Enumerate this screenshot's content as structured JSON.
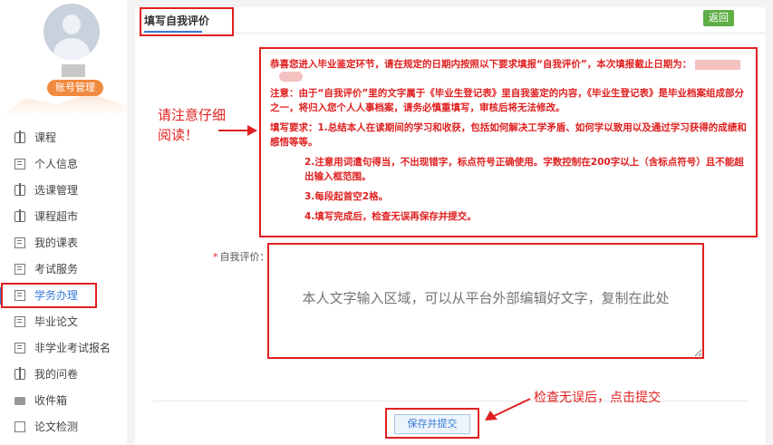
{
  "sidebar": {
    "account_button": "账号管理",
    "items": [
      {
        "label": "课程",
        "icon": "book-icon"
      },
      {
        "label": "个人信息",
        "icon": "list-icon"
      },
      {
        "label": "选课管理",
        "icon": "book-icon"
      },
      {
        "label": "课程超市",
        "icon": "book-icon"
      },
      {
        "label": "我的课表",
        "icon": "list-icon"
      },
      {
        "label": "考试服务",
        "icon": "list-icon"
      },
      {
        "label": "学务办理",
        "icon": "list-icon",
        "active": true
      },
      {
        "label": "毕业论文",
        "icon": "list-icon"
      },
      {
        "label": "非学业考试报名",
        "icon": "list-icon"
      },
      {
        "label": "我的问卷",
        "icon": "book-icon"
      },
      {
        "label": "收件箱",
        "icon": "mail-icon"
      },
      {
        "label": "论文检测",
        "icon": "doc-icon"
      }
    ]
  },
  "main": {
    "tab_title": "填写自我评价",
    "back_button": "返回",
    "notice": {
      "line1": "恭喜您进入毕业鉴定环节，请在规定的日期内按照以下要求填报“自我评价”，本次填报截止日期为：",
      "line2": "注意：由于“自我评价”里的文字属于《毕业生登记表》里自我鉴定的内容，《毕业生登记表》是毕业档案组成部分之一，将归入您个人人事档案，请务必慎重填写，审核后将无法修改。",
      "line3": "填写要求：1.总结本人在读期间的学习和收获，包括如何解决工学矛盾、如何学以致用以及通过学习获得的成绩和感悟等等。",
      "line4": "2.注意用词遣句得当，不出现错字，标点符号正确使用。字数控制在200字以上（含标点符号）且不能超出输入框范围。",
      "line5": "3.每段起首空2格。",
      "line6": "4.填写完成后，检查无误再保存并提交。"
    },
    "eval_label": "自我评价：",
    "eval_required_mark": "*",
    "eval_placeholder": "本人文字输入区域，可以从平台外部编辑好文字，复制在此处",
    "submit_button": "保存并提交"
  },
  "annotations": {
    "read_carefully": "请注意仔细阅读！",
    "submit_hint": "检查无误后，点击提交"
  },
  "colors": {
    "accent": "#3a7bd5",
    "annotation": "#e02020",
    "back": "#5fae46",
    "account": "#f08a40"
  }
}
